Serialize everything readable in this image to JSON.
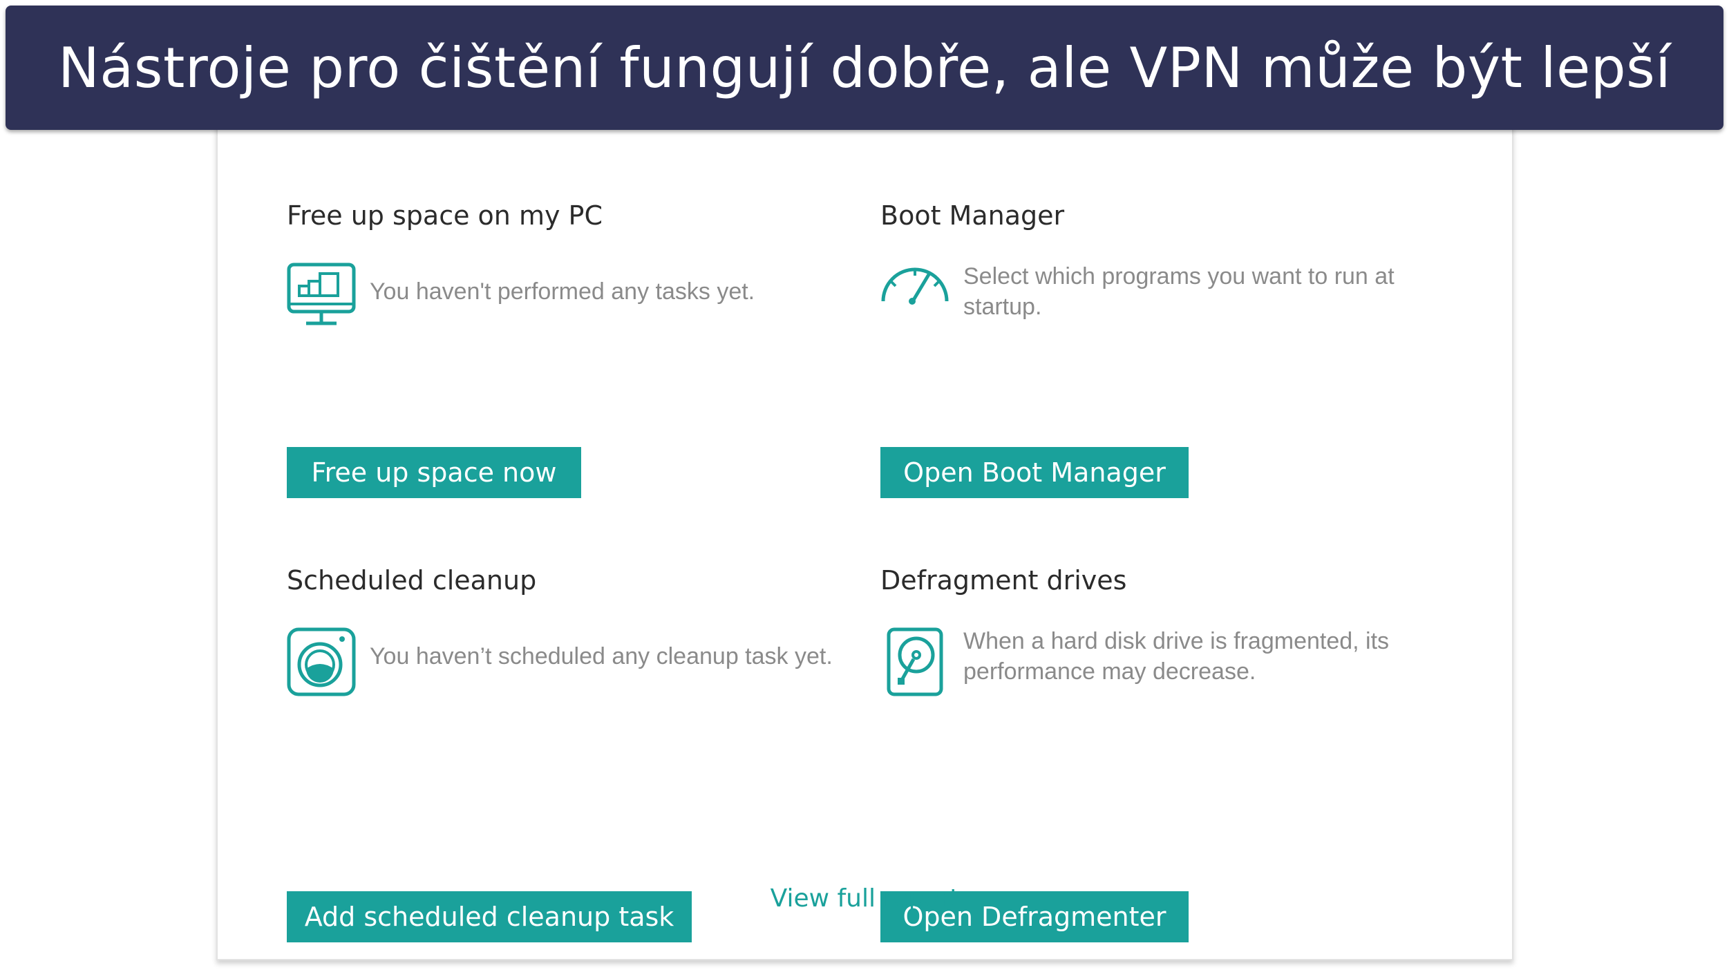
{
  "banner": {
    "title": "Nástroje pro čištění fungují dobře, ale VPN může být lepší"
  },
  "colors": {
    "banner_bg": "#2f3257",
    "accent": "#1aa19b",
    "title_text": "#2b2b2b",
    "desc_text": "#8a8a8a"
  },
  "cards": {
    "free_space": {
      "title": "Free up space on my PC",
      "icon": "monitor-icon",
      "description": "You haven't performed any tasks yet.",
      "button_label": "Free up space now"
    },
    "boot_manager": {
      "title": "Boot Manager",
      "icon": "speedometer-icon",
      "description": "Select which programs you want to run at startup.",
      "button_label": "Open Boot Manager"
    },
    "scheduled_cleanup": {
      "title": "Scheduled cleanup",
      "icon": "washing-machine-icon",
      "description": "You haven’t scheduled any cleanup task yet.",
      "button_label": "Add scheduled cleanup task"
    },
    "defragment": {
      "title": "Defragment drives",
      "icon": "hard-disk-icon",
      "description": "When a hard disk drive is fragmented, its performance may decrease.",
      "button_label": "Open Defragmenter"
    }
  },
  "footer": {
    "report_link": "View full report"
  }
}
